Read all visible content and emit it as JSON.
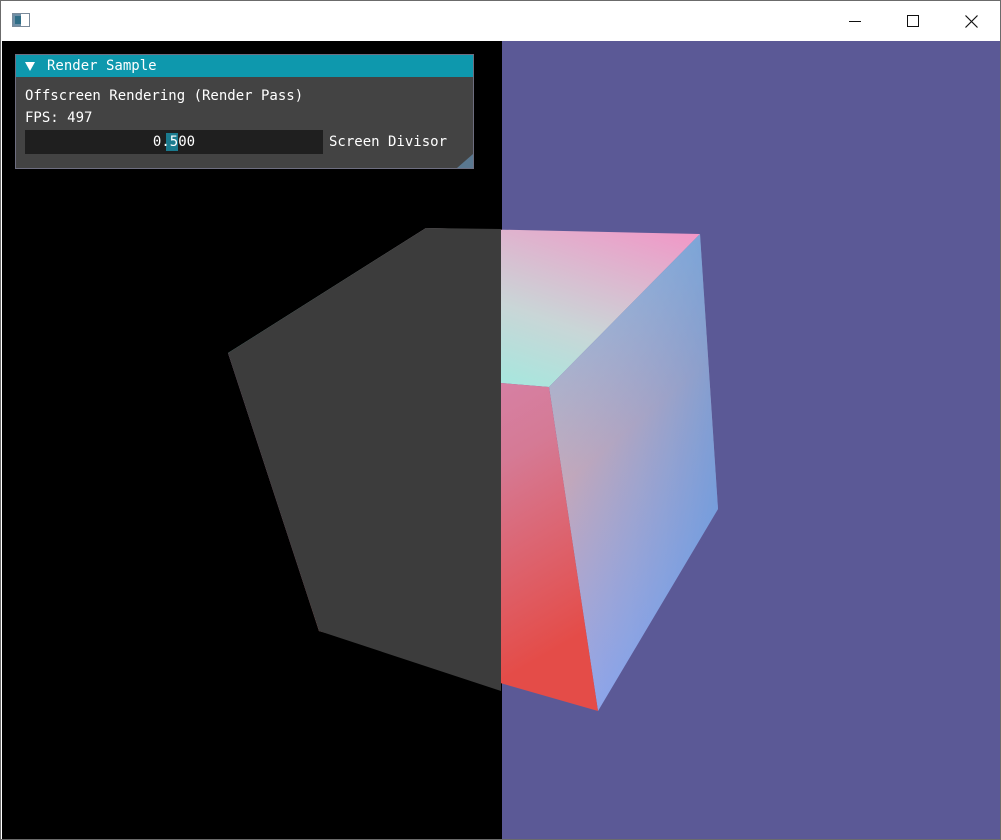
{
  "window": {
    "title": "",
    "controls": {
      "minimize_icon": "minimize-icon",
      "maximize_icon": "maximize-icon",
      "close_icon": "close-icon"
    }
  },
  "scene": {
    "left_background": "#000000",
    "right_background": "#5b5996"
  },
  "panel": {
    "title": "Render Sample",
    "title_bar_color": "#0e98ad",
    "collapse_icon": "triangle-down-icon",
    "description": "Offscreen Rendering (Render Pass)",
    "fps_text": "FPS: 497",
    "slider": {
      "value": 0.5,
      "display": "0.500",
      "label": "Screen Divisor"
    }
  }
}
